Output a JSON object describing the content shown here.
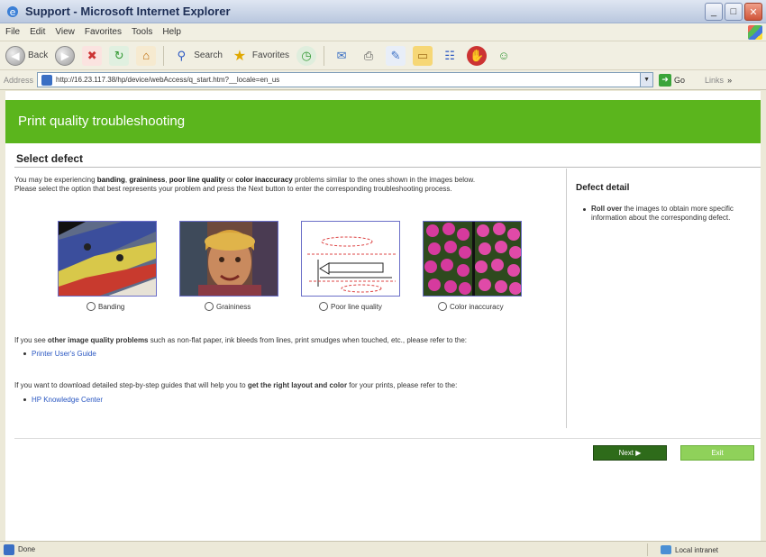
{
  "window": {
    "title": "Support - Microsoft Internet Explorer",
    "icon": "ie-icon"
  },
  "menu": [
    "File",
    "Edit",
    "View",
    "Favorites",
    "Tools",
    "Help"
  ],
  "toolbar": {
    "back_label": "Back",
    "search_label": "Search",
    "favorites_label": "Favorites"
  },
  "address": {
    "label": "Address",
    "url": "http://16.23.117.38/hp/device/webAccess/q_start.htm?__locale=en_us",
    "go_label": "Go",
    "links_label": "Links"
  },
  "page": {
    "banner_title": "Print quality troubleshooting",
    "section_title": "Select defect",
    "intro": {
      "t1": "You may be experiencing ",
      "b1": "banding",
      "t2": ", ",
      "b2": "graininess",
      "t3": ", ",
      "b3": "poor line quality",
      "t4": " or ",
      "b4": "color inaccuracy",
      "t5": " problems similar to the ones shown in the images below.",
      "line2": "Please select the option that best represents your problem and press the Next button to enter the corresponding troubleshooting process."
    },
    "defects": [
      {
        "label": "Banding"
      },
      {
        "label": "Graininess"
      },
      {
        "label": "Poor line quality"
      },
      {
        "label": "Color inaccuracy"
      }
    ],
    "other": {
      "t1": "If you see ",
      "b1": "other image quality problems",
      "t2": " such as non-flat paper, ink bleeds from lines, print smudges when touched, etc., please refer to the:",
      "link": "Printer User's Guide"
    },
    "download": {
      "t1": "If you want to download detailed step-by-step guides that will help you to ",
      "b1": "get the right layout and color",
      "t2": " for your prints, please refer to the:",
      "link": "HP Knowledge Center"
    },
    "side": {
      "title": "Defect detail",
      "b1": "Roll over",
      "text": " the images to obtain more specific information about the corresponding defect."
    },
    "buttons": {
      "next": "Next ▶",
      "exit": "Exit"
    }
  },
  "status": {
    "text": "Done",
    "zone": "Local intranet"
  }
}
